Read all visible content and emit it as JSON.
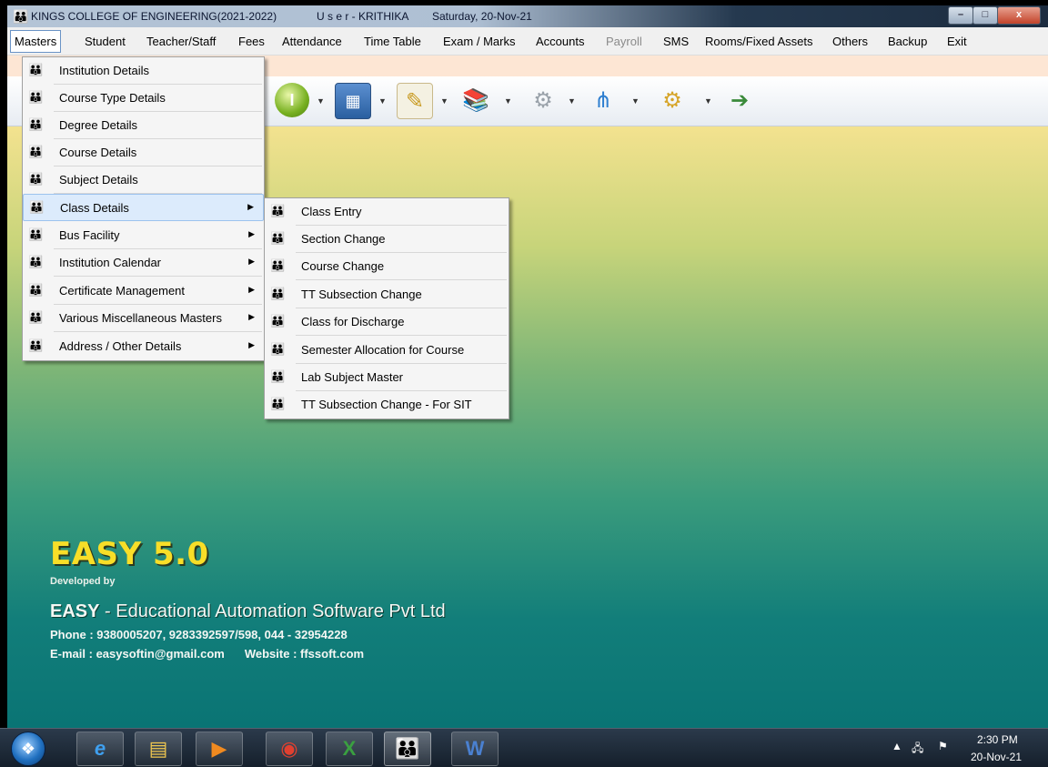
{
  "window": {
    "title": "KINGS COLLEGE OF ENGINEERING(2021-2022)",
    "user": "U s e r - KRITHIKA",
    "date": "Saturday, 20-Nov-21",
    "controls": {
      "minimize": "–",
      "maximize": "□",
      "close": "x"
    }
  },
  "menubar": [
    "Masters",
    "Student",
    "Teacher/Staff",
    "Fees",
    "Attendance",
    "Time Table",
    "Exam / Marks",
    "Accounts",
    "Payroll",
    "SMS",
    "Rooms/Fixed Assets",
    "Others",
    "Backup",
    "Exit"
  ],
  "masters_menu": [
    {
      "label": "Institution Details",
      "submenu": false
    },
    {
      "label": "Course Type Details",
      "submenu": false
    },
    {
      "label": "Degree Details",
      "submenu": false
    },
    {
      "label": "Course Details",
      "submenu": false
    },
    {
      "label": "Subject Details",
      "submenu": false
    },
    {
      "label": "Class Details",
      "submenu": true
    },
    {
      "label": "Bus Facility",
      "submenu": true
    },
    {
      "label": "Institution Calendar",
      "submenu": true
    },
    {
      "label": "Certificate Management",
      "submenu": true
    },
    {
      "label": "Various Miscellaneous Masters",
      "submenu": true
    },
    {
      "label": "Address / Other Details",
      "submenu": true
    }
  ],
  "class_details_submenu": [
    "Class Entry",
    "Section Change",
    "Course Change",
    "TT Subsection Change",
    "Class for Discharge",
    "Semester Allocation for Course",
    "Lab Subject Master",
    "TT Subsection Change - For SIT"
  ],
  "toolbar_icons": [
    "green-circle-icon",
    "calendar-icon",
    "notepad-icon",
    "books-icon",
    "gray-tool-icon",
    "network-icon",
    "gear-icon",
    "exit-door-icon"
  ],
  "branding": {
    "product": "EASY 5.0",
    "developed_by": "Developed by",
    "company_bold": "EASY",
    "company_rest": " - Educational Automation Software Pvt Ltd",
    "phone": "Phone : 9380005207, 9283392597/598,  044 - 32954228",
    "email": "E-mail : easysoftin@gmail.com",
    "website": "Website : ffssoft.com"
  },
  "taskbar": {
    "apps": [
      "internet-explorer-icon",
      "file-explorer-icon",
      "media-player-icon",
      "chrome-icon",
      "excel-icon",
      "easy-app-icon",
      "word-icon"
    ],
    "time": "2:30 PM",
    "date": "20-Nov-21"
  }
}
